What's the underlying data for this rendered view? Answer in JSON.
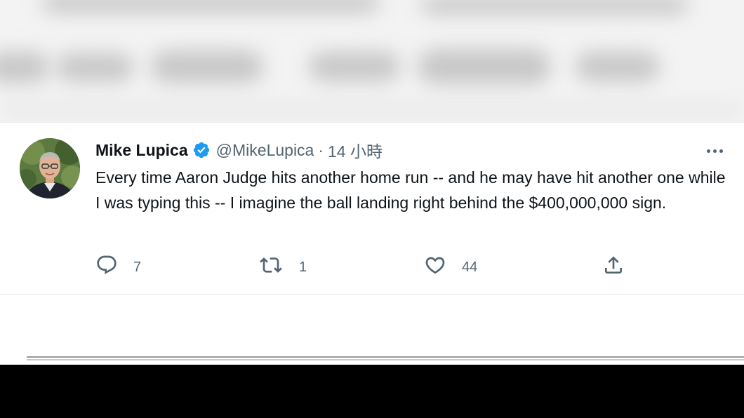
{
  "tweet": {
    "display_name": "Mike Lupica",
    "verified": true,
    "handle": "@MikeLupica",
    "separator": "·",
    "timestamp": "14 小時",
    "text": "Every time Aaron Judge hits another home run -- and he may have hit another one while I was typing this -- I imagine the ball landing right behind the $400,000,000 sign.",
    "actions": {
      "reply_count": "7",
      "retweet_count": "1",
      "like_count": "44"
    }
  },
  "icons": {
    "verified": "verified-badge-icon",
    "more": "more-horizontal-icon",
    "reply": "reply-icon",
    "retweet": "retweet-icon",
    "like": "heart-icon",
    "share": "share-icon"
  },
  "colors": {
    "verified_blue": "#1d9bf0",
    "text_primary": "#0f1419",
    "text_secondary": "#536471"
  }
}
